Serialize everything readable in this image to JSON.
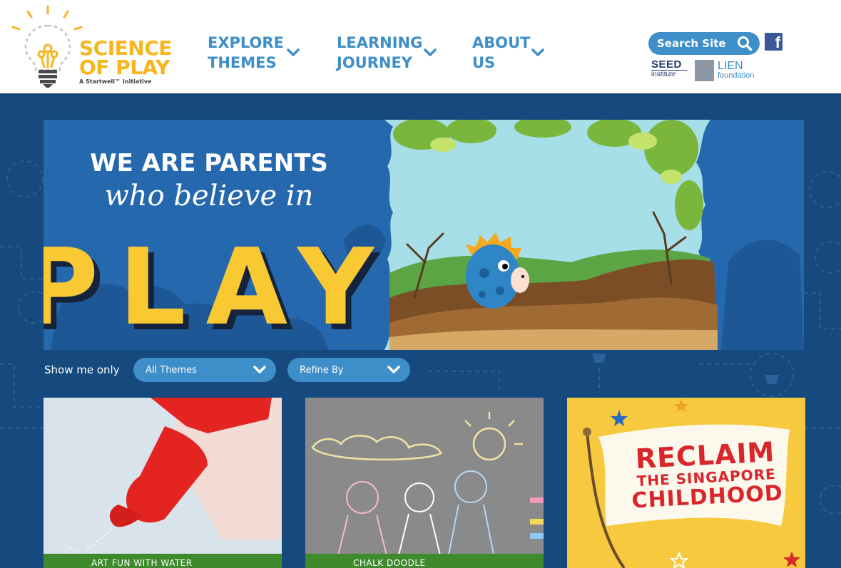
{
  "brand": {
    "line1": "SCIENCE",
    "line2": "OF PLAY",
    "tagline": "A Startwell™ Initiative"
  },
  "nav": [
    {
      "line1": "EXPLORE",
      "line2": "THEMES"
    },
    {
      "line1": "LEARNING",
      "line2": "JOURNEY"
    },
    {
      "line1": "ABOUT",
      "line2": "US"
    }
  ],
  "search": {
    "label": "Search Site"
  },
  "partners": {
    "seed_word": "SEED",
    "seed_sub": "institute",
    "lien_name": "LIEN",
    "lien_sub": "foundation"
  },
  "hero": {
    "line1": "WE ARE PARENTS",
    "line2": "who believe in",
    "line3": "PLAY"
  },
  "filters": {
    "label": "Show me only",
    "themes_value": "All Themes",
    "refine_value": "Refine By"
  },
  "cards": [
    {
      "caption": "ART FUN WITH WATER"
    },
    {
      "caption": "CHALK DOODLE"
    },
    {
      "line1": "RECLAIM",
      "line2": "THE SINGAPORE",
      "line3": "CHILDHOOD"
    }
  ],
  "colors": {
    "brand_yellow": "#f7b51e",
    "nav_blue": "#3d8ec9",
    "page_navy": "#164a7e",
    "caption_green": "#3e8a2d"
  }
}
